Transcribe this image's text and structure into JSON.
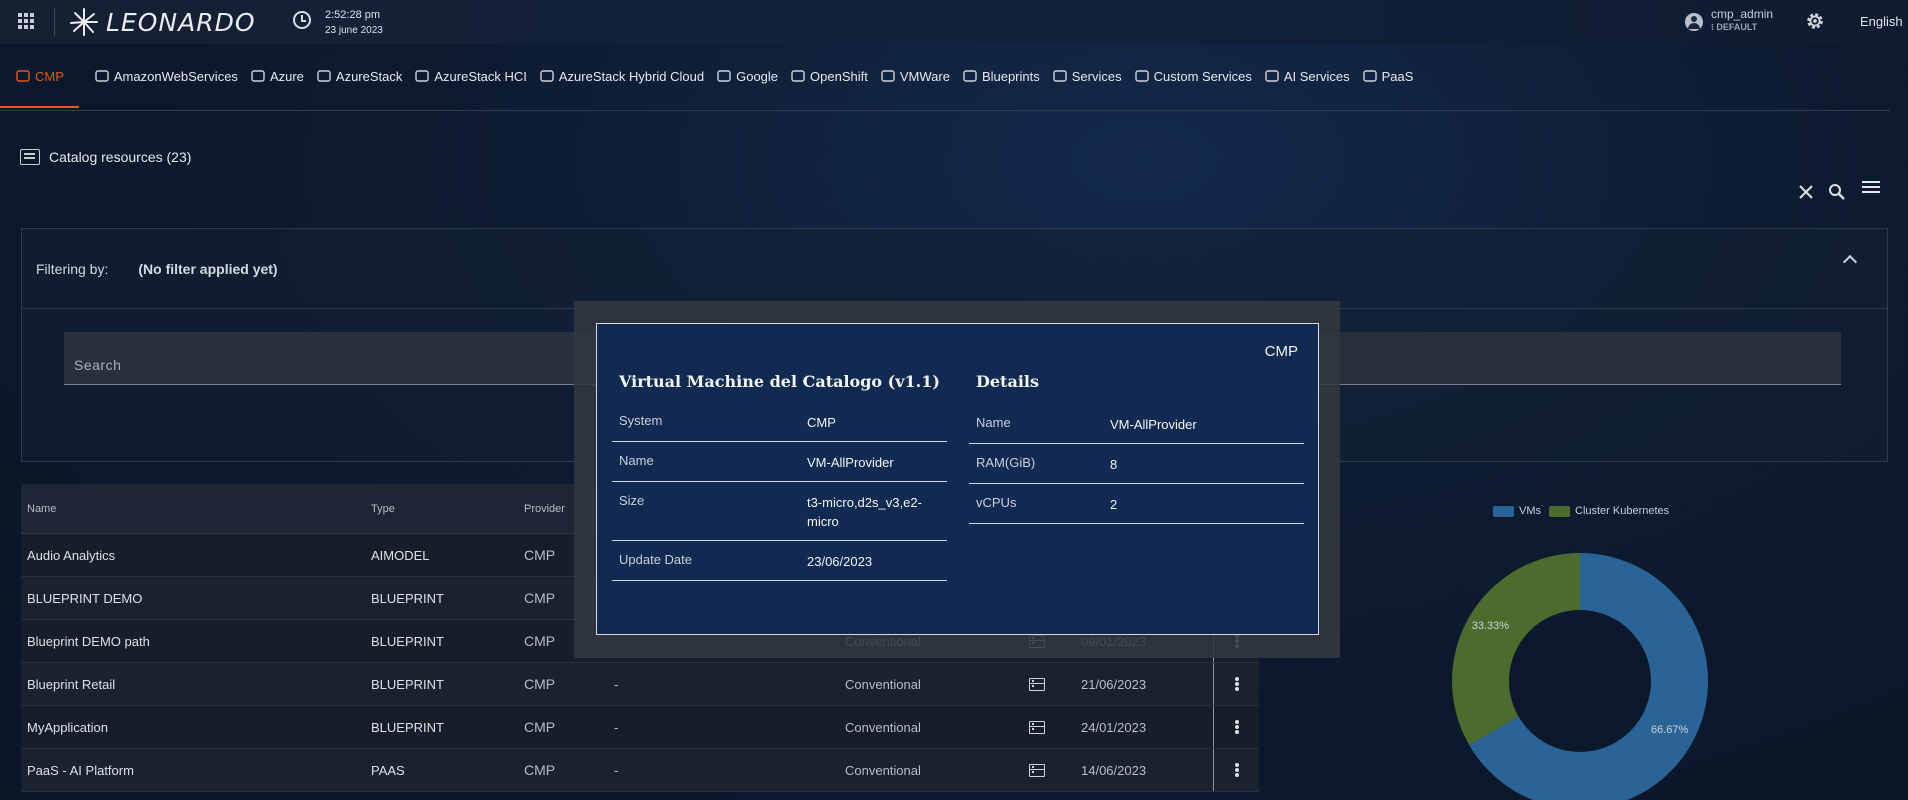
{
  "header": {
    "brand": "LEONARDO",
    "time": "2:52:28 pm",
    "date": "23 june 2023",
    "user": "cmp_admin",
    "role": "DEFAULT",
    "language": "English"
  },
  "nav": {
    "items": [
      {
        "label": "CMP",
        "icon": "cmp-icon",
        "active": true
      },
      {
        "label": "AmazonWebServices",
        "icon": "aws-icon"
      },
      {
        "label": "Azure",
        "icon": "azure-icon"
      },
      {
        "label": "AzureStack",
        "icon": "cloud-icon"
      },
      {
        "label": "AzureStack HCI",
        "icon": "cloud-icon"
      },
      {
        "label": "AzureStack Hybrid Cloud",
        "icon": "arrow-icon"
      },
      {
        "label": "Google",
        "icon": "google-icon"
      },
      {
        "label": "OpenShift",
        "icon": "branch-icon"
      },
      {
        "label": "VMWare",
        "icon": "monitor-icon"
      },
      {
        "label": "Blueprints",
        "icon": "blueprint-icon"
      },
      {
        "label": "Services",
        "icon": "grid-icon"
      },
      {
        "label": "Custom Services",
        "icon": "user-gear-icon"
      },
      {
        "label": "AI Services",
        "icon": "ai-icon"
      },
      {
        "label": "PaaS",
        "icon": "layers-icon"
      }
    ]
  },
  "catalog": {
    "title": "Catalog resources (23)"
  },
  "filter": {
    "label": "Filtering by:",
    "value": "(No filter applied yet)",
    "search_placeholder": "Search"
  },
  "table": {
    "headers": {
      "name": "Name",
      "type": "Type",
      "provider": "Provider"
    },
    "rows": [
      {
        "name": "Audio Analytics",
        "type": "AIMODEL",
        "provider": "CMP",
        "dash": "",
        "mode": "",
        "date": ""
      },
      {
        "name": "BLUEPRINT DEMO",
        "type": "BLUEPRINT",
        "provider": "CMP",
        "dash": "",
        "mode": "",
        "date": ""
      },
      {
        "name": "Blueprint DEMO path",
        "type": "BLUEPRINT",
        "provider": "CMP",
        "dash": "-",
        "mode": "Conventional",
        "date": "09/01/2023"
      },
      {
        "name": "Blueprint Retail",
        "type": "BLUEPRINT",
        "provider": "CMP",
        "dash": "-",
        "mode": "Conventional",
        "date": "21/06/2023"
      },
      {
        "name": "MyApplication",
        "type": "BLUEPRINT",
        "provider": "CMP",
        "dash": "-",
        "mode": "Conventional",
        "date": "24/01/2023"
      },
      {
        "name": "PaaS - AI Platform",
        "type": "PAAS",
        "provider": "CMP",
        "dash": "-",
        "mode": "Conventional",
        "date": "14/06/2023"
      }
    ]
  },
  "chart_data": {
    "type": "pie",
    "categories": [
      "VMs",
      "Cluster Kubernetes"
    ],
    "values": [
      66.67,
      33.33
    ],
    "labels": [
      "66.67%",
      "33.33%"
    ],
    "colors": [
      "#2a6496",
      "#4c6b2c"
    ],
    "legend_position": "top",
    "donut": true
  },
  "modal": {
    "system_tag": "CMP",
    "left_title": "Virtual Machine del Catalogo (v1.1)",
    "left_rows": [
      {
        "key": "System",
        "value": "CMP"
      },
      {
        "key": "Name",
        "value": "VM-AllProvider"
      },
      {
        "key": "Size",
        "value": "t3-micro,d2s_v3,e2-micro"
      },
      {
        "key": "Update Date",
        "value": "23/06/2023"
      }
    ],
    "right_title": "Details",
    "right_rows": [
      {
        "key": "Name",
        "value": "VM-AllProvider"
      },
      {
        "key": "RAM(GiB)",
        "value": "8"
      },
      {
        "key": "vCPUs",
        "value": "2"
      }
    ]
  }
}
